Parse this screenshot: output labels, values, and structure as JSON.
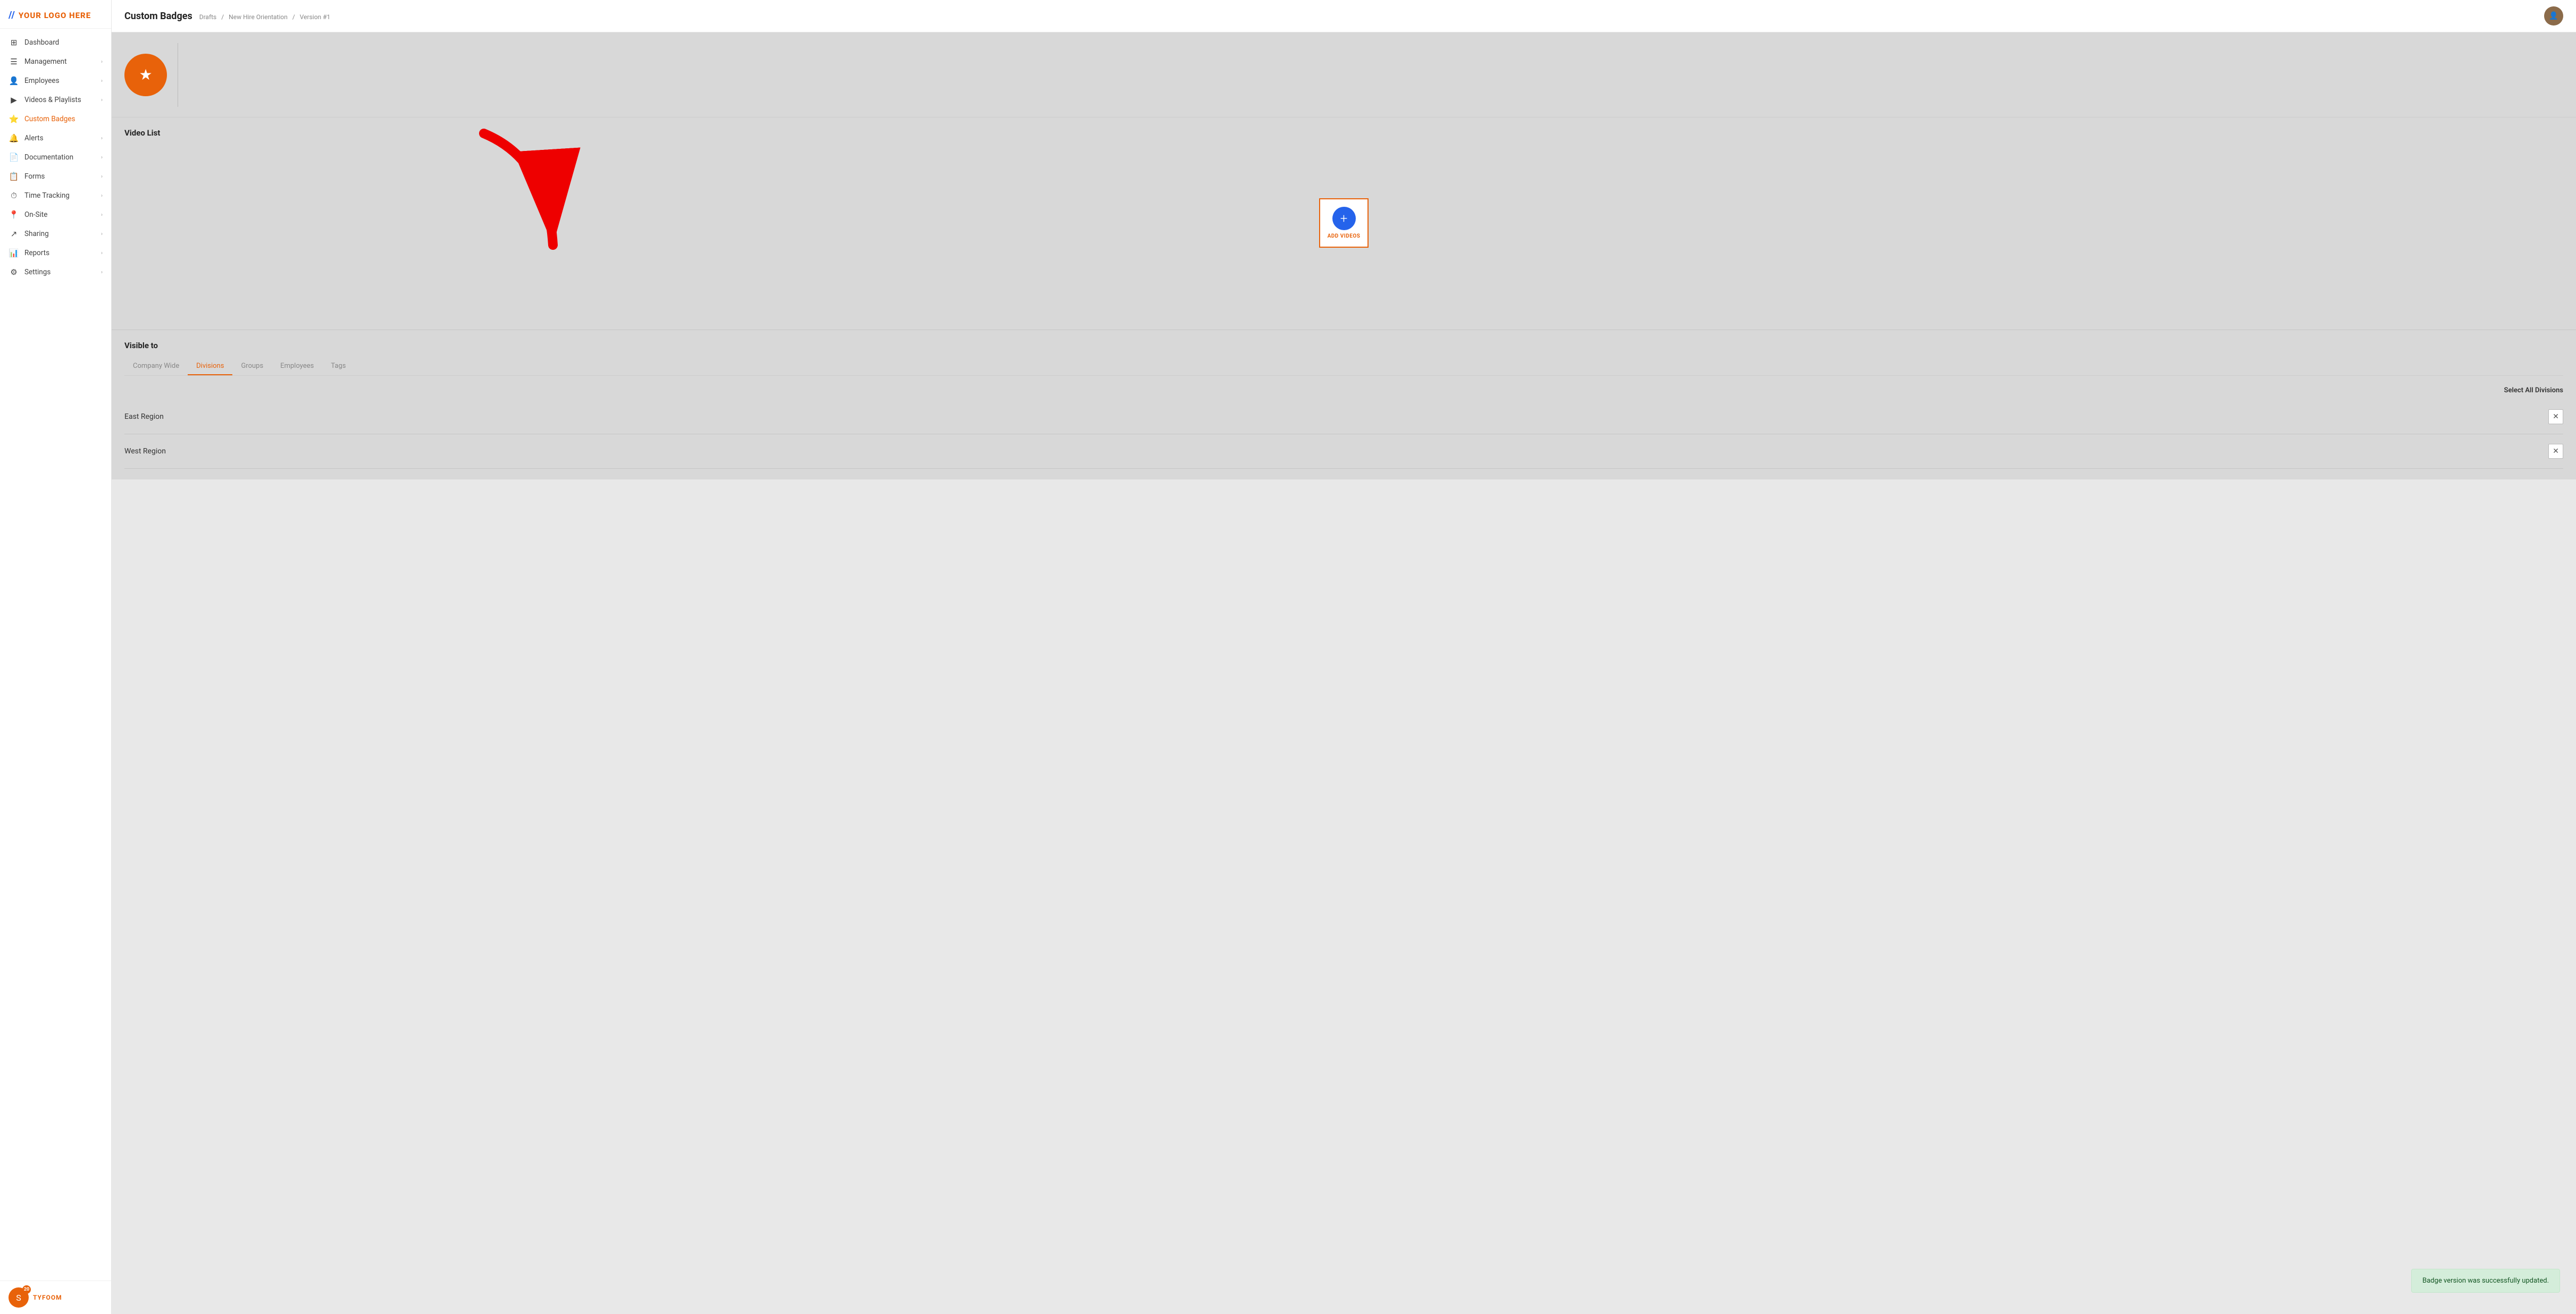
{
  "logo": {
    "icon": "//",
    "text": "YOUR LOGO HERE"
  },
  "sidebar": {
    "items": [
      {
        "id": "dashboard",
        "label": "Dashboard",
        "icon": "⊞",
        "hasChevron": false
      },
      {
        "id": "management",
        "label": "Management",
        "icon": "☰",
        "hasChevron": true
      },
      {
        "id": "employees",
        "label": "Employees",
        "icon": "👤",
        "hasChevron": true
      },
      {
        "id": "videos-playlists",
        "label": "Videos & Playlists",
        "icon": "▶",
        "hasChevron": true
      },
      {
        "id": "custom-badges",
        "label": "Custom Badges",
        "icon": "⭐",
        "hasChevron": false,
        "active": true
      },
      {
        "id": "alerts",
        "label": "Alerts",
        "icon": "🔔",
        "hasChevron": true
      },
      {
        "id": "documentation",
        "label": "Documentation",
        "icon": "📄",
        "hasChevron": true
      },
      {
        "id": "forms",
        "label": "Forms",
        "icon": "📋",
        "hasChevron": true
      },
      {
        "id": "time-tracking",
        "label": "Time Tracking",
        "icon": "⏱",
        "hasChevron": true
      },
      {
        "id": "on-site",
        "label": "On-Site",
        "icon": "📍",
        "hasChevron": true
      },
      {
        "id": "sharing",
        "label": "Sharing",
        "icon": "↗",
        "hasChevron": true
      },
      {
        "id": "reports",
        "label": "Reports",
        "icon": "📊",
        "hasChevron": true
      },
      {
        "id": "settings",
        "label": "Settings",
        "icon": "⚙",
        "hasChevron": true
      }
    ]
  },
  "footer": {
    "badge_count": "20",
    "label": "TYFOOM"
  },
  "header": {
    "title": "Custom Badges",
    "breadcrumb": {
      "part1": "Drafts",
      "sep1": "/",
      "part2": "New Hire Orientation",
      "sep2": "/",
      "part3": "Version #1"
    }
  },
  "video_list": {
    "section_title": "Video List",
    "add_button_label": "ADD VIDEOS"
  },
  "visible_to": {
    "section_title": "Visible to",
    "tabs": [
      {
        "id": "company-wide",
        "label": "Company Wide",
        "active": false
      },
      {
        "id": "divisions",
        "label": "Divisions",
        "active": true
      },
      {
        "id": "groups",
        "label": "Groups",
        "active": false
      },
      {
        "id": "employees",
        "label": "Employees",
        "active": false
      },
      {
        "id": "tags",
        "label": "Tags",
        "active": false
      }
    ],
    "select_all_label": "Select All Divisions",
    "divisions": [
      {
        "name": "East Region"
      },
      {
        "name": "West Region"
      }
    ]
  },
  "toast": {
    "message": "Badge version was successfully updated."
  }
}
